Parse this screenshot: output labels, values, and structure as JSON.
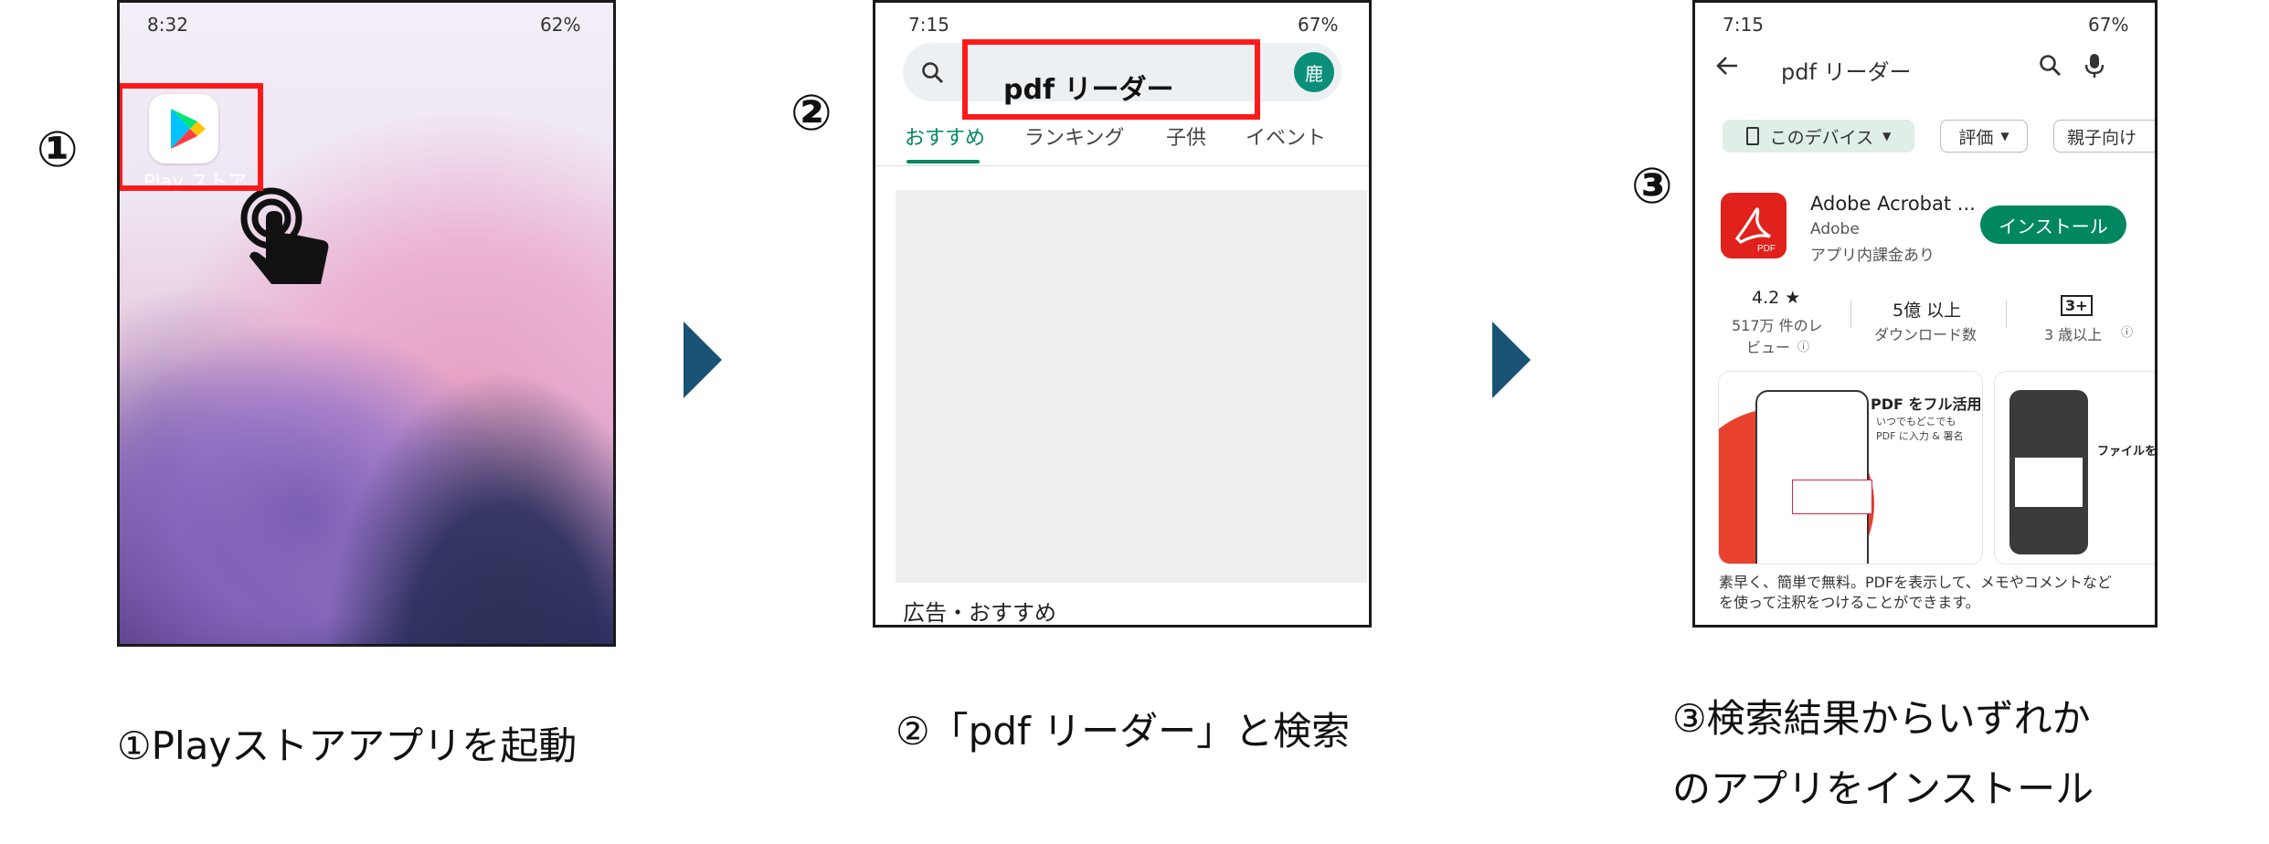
{
  "steps": [
    {
      "number": "①",
      "caption_lines": [
        "①Playストアアプリを起動"
      ],
      "phone": {
        "status_time": "8:32",
        "status_right": "62%",
        "app_icon_label": "Play ストア",
        "icon": "play-store-icon"
      }
    },
    {
      "number": "②",
      "caption_lines": [
        "②「pdf リーダー」と検索"
      ],
      "phone": {
        "status_time": "7:15",
        "status_right": "67%",
        "search_text": "pdf リーダー",
        "avatar": "鹿",
        "tabs": [
          "おすすめ",
          "ランキング",
          "子供",
          "イベント"
        ],
        "section_label": "広告・おすすめ"
      }
    },
    {
      "number": "③",
      "caption_lines": [
        "③検索結果からいずれか",
        "のアプリをインストール"
      ],
      "phone": {
        "status_time": "7:15",
        "status_right": "67%",
        "query": "pdf リーダー",
        "filter_chips": [
          "このデバイス",
          "評価",
          "親子向け"
        ],
        "app_name": "Adobe Acrobat ...",
        "developer": "Adobe",
        "iap_note": "アプリ内課金あり",
        "install_label": "インストール",
        "rating": "4.2 ★",
        "reviews_line1": "517万 件のレ",
        "reviews_line2": "ビュー",
        "downloads": "5億 以上",
        "downloads_label": "ダウンロード数",
        "age_badge": "3+",
        "age_label": "3 歳以上",
        "promo_title": "PDF をフル活用",
        "promo_sub1": "いつでもどこでも",
        "promo_sub2": "PDF に入力 & 署名",
        "promo2_title": "ファイルを",
        "description": "素早く、簡単で無料。PDFを表示して、メモやコメントなどを使って注釈をつけることができます。"
      }
    }
  ],
  "colors": {
    "arrow": "#1a5276",
    "highlight": "#ff1a1a",
    "install": "#01875f"
  }
}
